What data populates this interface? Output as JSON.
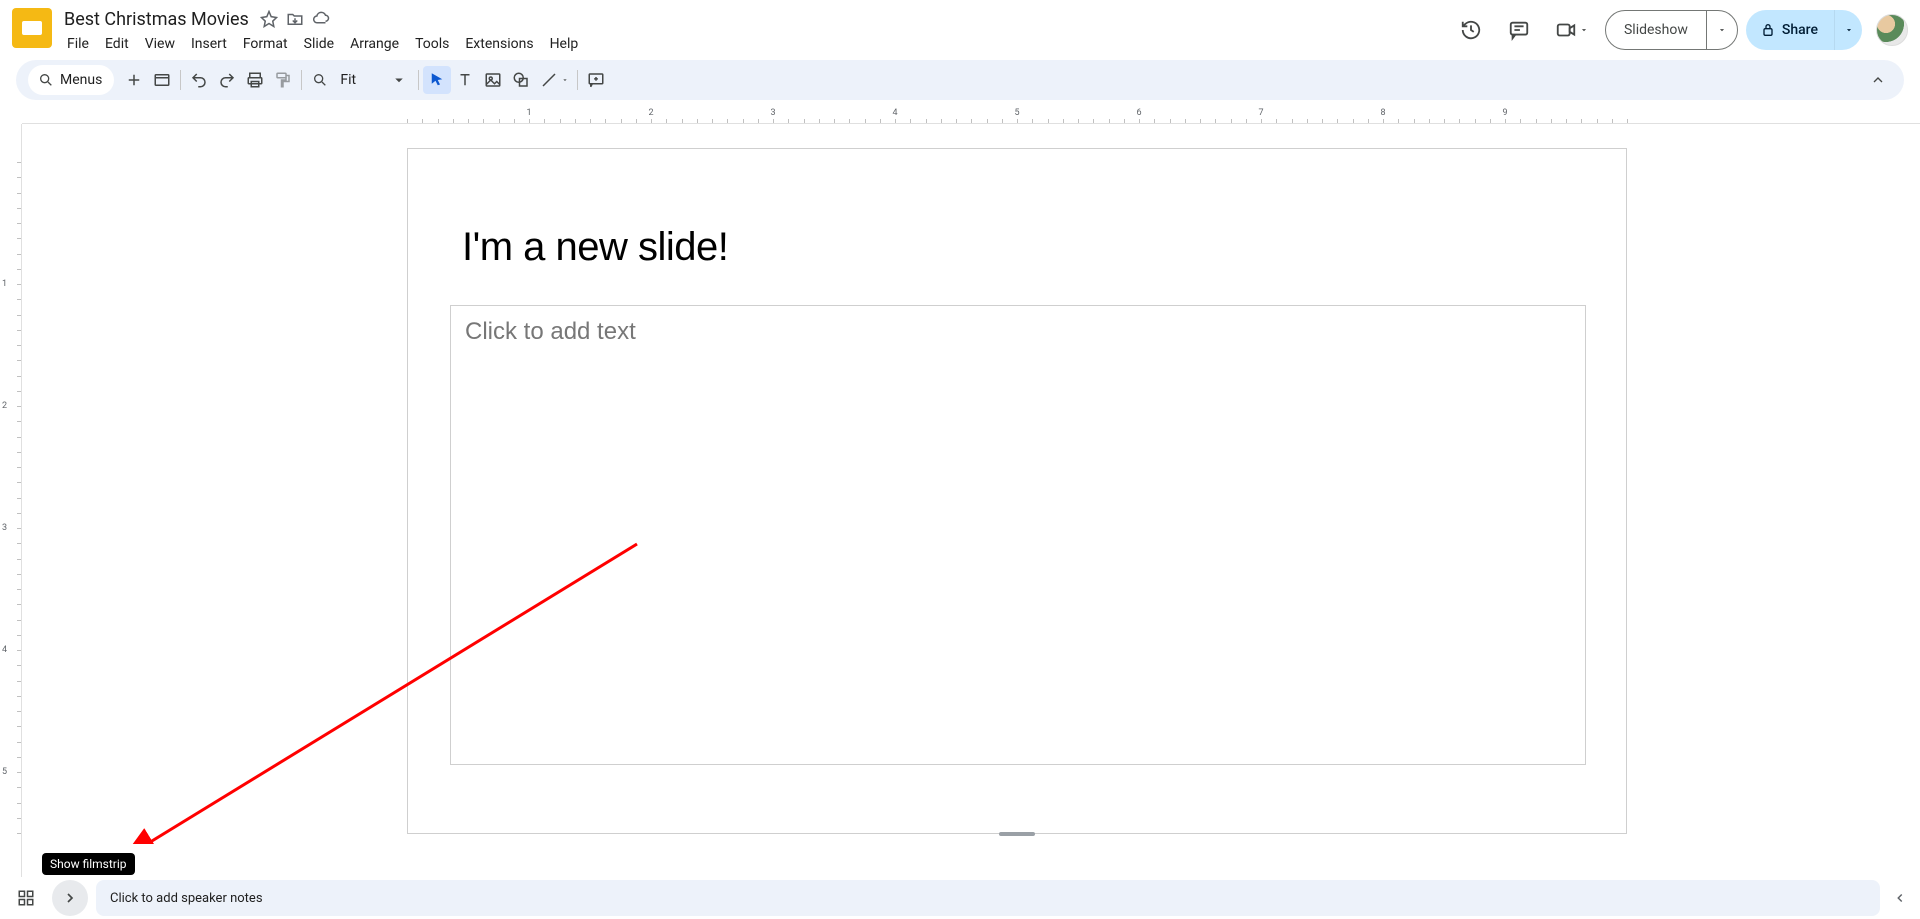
{
  "doc": {
    "title": "Best Christmas Movies"
  },
  "menubar": [
    {
      "label": "File"
    },
    {
      "label": "Edit"
    },
    {
      "label": "View"
    },
    {
      "label": "Insert"
    },
    {
      "label": "Format"
    },
    {
      "label": "Slide"
    },
    {
      "label": "Arrange"
    },
    {
      "label": "Tools"
    },
    {
      "label": "Extensions"
    },
    {
      "label": "Help"
    }
  ],
  "header": {
    "slideshow_label": "Slideshow",
    "share_label": "Share"
  },
  "toolbar": {
    "menus_label": "Menus",
    "zoom_label": "Fit"
  },
  "slide": {
    "title": "I'm a new slide!",
    "body_placeholder": "Click to add text"
  },
  "speaker_notes_placeholder": "Click to add speaker notes",
  "tooltip": "Show filmstrip",
  "ruler_h": [
    "1",
    "2",
    "3",
    "4",
    "5",
    "6",
    "7",
    "8",
    "9"
  ],
  "ruler_v": [
    "1",
    "2",
    "3",
    "4",
    "5"
  ]
}
